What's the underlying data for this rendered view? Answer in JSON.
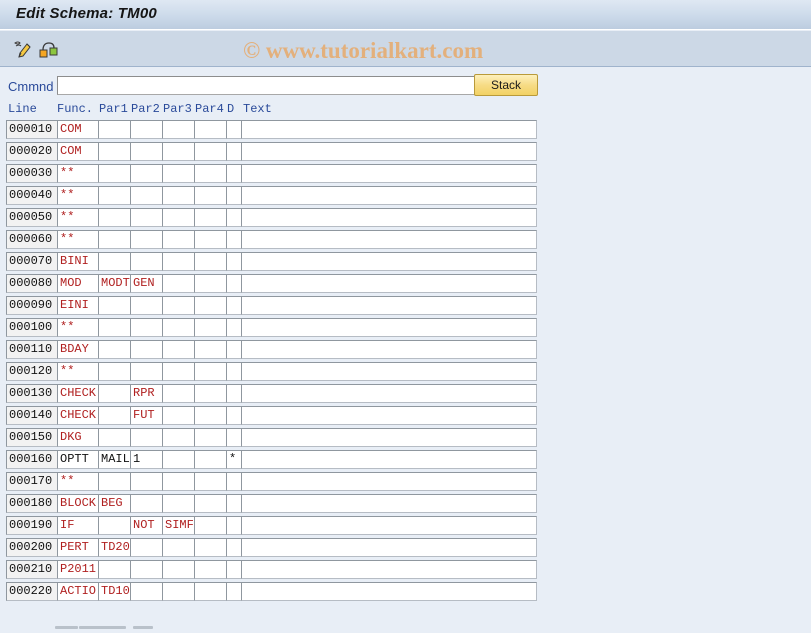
{
  "window": {
    "title": "Edit Schema: TM00"
  },
  "toolbar": {
    "icons": [
      {
        "name": "display-change-pencil-icon",
        "glyph": "✎"
      },
      {
        "name": "structure-hierarchy-icon",
        "glyph": "⚬"
      }
    ]
  },
  "watermark": {
    "text": "© www.tutorialkart.com",
    "color": "#e3b07c"
  },
  "command": {
    "label": "Cmmnd",
    "value": "",
    "placeholder": "",
    "stack_label": "Stack"
  },
  "table": {
    "columns": [
      "Line",
      "Func.",
      "Par1",
      "Par2",
      "Par3",
      "Par4",
      "D",
      "Text"
    ],
    "rows": [
      {
        "line": "000010",
        "func": "COM",
        "par1": "",
        "par2": "",
        "par3": "",
        "par4": "",
        "d": "",
        "text": "",
        "black": false
      },
      {
        "line": "000020",
        "func": "COM",
        "par1": "",
        "par2": "",
        "par3": "",
        "par4": "",
        "d": "",
        "text": "",
        "black": false
      },
      {
        "line": "000030",
        "func": "**",
        "par1": "",
        "par2": "",
        "par3": "",
        "par4": "",
        "d": "",
        "text": "",
        "black": false
      },
      {
        "line": "000040",
        "func": "**",
        "par1": "",
        "par2": "",
        "par3": "",
        "par4": "",
        "d": "",
        "text": "",
        "black": false
      },
      {
        "line": "000050",
        "func": "**",
        "par1": "",
        "par2": "",
        "par3": "",
        "par4": "",
        "d": "",
        "text": "",
        "black": false
      },
      {
        "line": "000060",
        "func": "**",
        "par1": "",
        "par2": "",
        "par3": "",
        "par4": "",
        "d": "",
        "text": "",
        "black": false
      },
      {
        "line": "000070",
        "func": "BINI",
        "par1": "",
        "par2": "",
        "par3": "",
        "par4": "",
        "d": "",
        "text": "",
        "black": false
      },
      {
        "line": "000080",
        "func": "MOD",
        "par1": "MODT",
        "par2": "GEN",
        "par3": "",
        "par4": "",
        "d": "",
        "text": "",
        "black": false
      },
      {
        "line": "000090",
        "func": "EINI",
        "par1": "",
        "par2": "",
        "par3": "",
        "par4": "",
        "d": "",
        "text": "",
        "black": false
      },
      {
        "line": "000100",
        "func": "**",
        "par1": "",
        "par2": "",
        "par3": "",
        "par4": "",
        "d": "",
        "text": "",
        "black": false
      },
      {
        "line": "000110",
        "func": "BDAY",
        "par1": "",
        "par2": "",
        "par3": "",
        "par4": "",
        "d": "",
        "text": "",
        "black": false
      },
      {
        "line": "000120",
        "func": "**",
        "par1": "",
        "par2": "",
        "par3": "",
        "par4": "",
        "d": "",
        "text": "",
        "black": false
      },
      {
        "line": "000130",
        "func": "CHECK",
        "par1": "",
        "par2": "RPR",
        "par3": "",
        "par4": "",
        "d": "",
        "text": "",
        "black": false
      },
      {
        "line": "000140",
        "func": "CHECK",
        "par1": "",
        "par2": "FUT",
        "par3": "",
        "par4": "",
        "d": "",
        "text": "",
        "black": false
      },
      {
        "line": "000150",
        "func": "DKG",
        "par1": "",
        "par2": "",
        "par3": "",
        "par4": "",
        "d": "",
        "text": "",
        "black": false
      },
      {
        "line": "000160",
        "func": "OPTT",
        "par1": "MAIL",
        "par2": "1",
        "par3": "",
        "par4": "",
        "d": "*",
        "text": "",
        "black": true
      },
      {
        "line": "000170",
        "func": "**",
        "par1": "",
        "par2": "",
        "par3": "",
        "par4": "",
        "d": "",
        "text": "",
        "black": false
      },
      {
        "line": "000180",
        "func": "BLOCK",
        "par1": "BEG",
        "par2": "",
        "par3": "",
        "par4": "",
        "d": "",
        "text": "",
        "black": false
      },
      {
        "line": "000190",
        "func": "IF",
        "par1": "",
        "par2": "NOT",
        "par3": "SIMF",
        "par4": "",
        "d": "",
        "text": "",
        "black": false
      },
      {
        "line": "000200",
        "func": "PERT",
        "par1": "TD20",
        "par2": "",
        "par3": "",
        "par4": "",
        "d": "",
        "text": "",
        "black": false
      },
      {
        "line": "000210",
        "func": "P2011",
        "par1": "",
        "par2": "",
        "par3": "",
        "par4": "",
        "d": "",
        "text": "",
        "black": false
      },
      {
        "line": "000220",
        "func": "ACTIO",
        "par1": "TD10",
        "par2": "",
        "par3": "",
        "par4": "",
        "d": "",
        "text": "",
        "black": false
      }
    ]
  },
  "colors": {
    "title_band": "#ccdaea",
    "toolbar_band": "#ccd8e6",
    "body_bg": "#e8eef6",
    "entry_red": "#b02020",
    "header_blue": "#2a4a9a",
    "stack_yellow": "#f2d264"
  }
}
